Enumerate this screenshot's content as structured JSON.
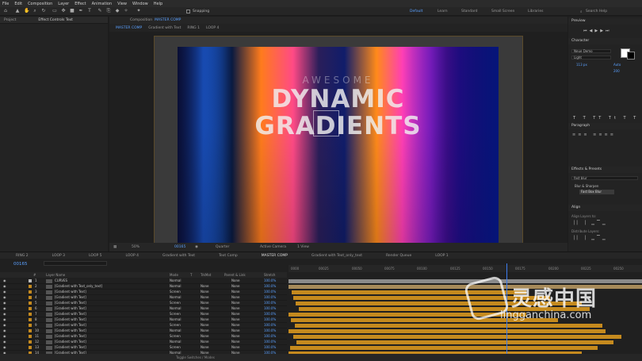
{
  "menu": [
    "File",
    "Edit",
    "Composition",
    "Layer",
    "Effect",
    "Animation",
    "View",
    "Window",
    "Help"
  ],
  "toolbar": {
    "snapping": "Snapping",
    "workspaces": [
      "Default",
      "Learn",
      "Standard",
      "Small Screen",
      "Libraries"
    ],
    "search": "Search Help"
  },
  "left_panel": {
    "tabs": [
      "Project",
      "Effect Controls Text"
    ]
  },
  "comp": {
    "tab_prefix": "Composition",
    "tab_name": "MASTER COMP",
    "crumbs": [
      "MASTER COMP",
      "Gradient with Text",
      "RING 1",
      "LOOP 4"
    ],
    "art": {
      "line1": "AWESOME",
      "line2": "DYNAMIC",
      "line3": "GRADIENTS"
    },
    "footer": {
      "zoom": "50%",
      "timecode": "00165",
      "resolution": "Quarter",
      "camera": "Active Camera",
      "view": "1 View"
    }
  },
  "right_panel": {
    "preview": "Preview",
    "character": "Character",
    "font": "Neue Demo",
    "style": "Light",
    "size": "113 px",
    "leading": "Auto",
    "tracking": "200",
    "paragraph": "Paragraph",
    "effects": "Effects & Presets",
    "effects_search": "fast blur",
    "effects_group": "Blur & Sharpen",
    "effects_item": "Fast Box Blur",
    "align": "Align",
    "align_to": "Align Layers to:",
    "distribute": "Distribute Layers:"
  },
  "bottom_tabs": [
    "RING 2",
    "LOOP 3",
    "LOOP 5",
    "LOOP 4",
    "Gradient with Text",
    "Text Comp",
    "MASTER COMP",
    "Gradient with Text_only_text",
    "Render Queue",
    "LOOP 1"
  ],
  "timeline": {
    "timecode": "00165",
    "headers": [
      "#",
      "Layer Name",
      "Mode",
      "T",
      "TrkMat",
      "Parent & Link",
      "Stretch"
    ],
    "ruler": [
      "0000",
      "00025",
      "00050",
      "00075",
      "00100",
      "00125",
      "00150",
      "00175",
      "00200",
      "00225",
      "00250"
    ],
    "layers": [
      {
        "num": "1",
        "name": "CURVES",
        "mode": "Normal",
        "trkmat": "",
        "parent": "None",
        "stretch": "100.0%"
      },
      {
        "num": "2",
        "name": "[Gradient with Text_only_text]",
        "mode": "Normal",
        "trkmat": "None",
        "parent": "None",
        "stretch": "100.0%"
      },
      {
        "num": "3",
        "name": "[Gradient with Text]",
        "mode": "Screen",
        "trkmat": "None",
        "parent": "None",
        "stretch": "100.0%"
      },
      {
        "num": "4",
        "name": "[Gradient with Text]",
        "mode": "Normal",
        "trkmat": "None",
        "parent": "None",
        "stretch": "100.0%"
      },
      {
        "num": "5",
        "name": "[Gradient with Text]",
        "mode": "Screen",
        "trkmat": "None",
        "parent": "None",
        "stretch": "100.0%"
      },
      {
        "num": "6",
        "name": "[Gradient with Text]",
        "mode": "Normal",
        "trkmat": "None",
        "parent": "None",
        "stretch": "100.0%"
      },
      {
        "num": "7",
        "name": "[Gradient with Text]",
        "mode": "Screen",
        "trkmat": "None",
        "parent": "None",
        "stretch": "100.0%"
      },
      {
        "num": "8",
        "name": "[Gradient with Text]",
        "mode": "Normal",
        "trkmat": "None",
        "parent": "None",
        "stretch": "100.0%"
      },
      {
        "num": "9",
        "name": "[Gradient with Text]",
        "mode": "Screen",
        "trkmat": "None",
        "parent": "None",
        "stretch": "100.0%"
      },
      {
        "num": "10",
        "name": "[Gradient with Text]",
        "mode": "Normal",
        "trkmat": "None",
        "parent": "None",
        "stretch": "100.0%"
      },
      {
        "num": "11",
        "name": "[Gradient with Text]",
        "mode": "Screen",
        "trkmat": "None",
        "parent": "None",
        "stretch": "100.0%"
      },
      {
        "num": "12",
        "name": "[Gradient with Text]",
        "mode": "Normal",
        "trkmat": "None",
        "parent": "None",
        "stretch": "100.0%"
      },
      {
        "num": "13",
        "name": "[Gradient with Text]",
        "mode": "Screen",
        "trkmat": "None",
        "parent": "None",
        "stretch": "100.0%"
      },
      {
        "num": "14",
        "name": "[Gradient with Text]",
        "mode": "Normal",
        "trkmat": "None",
        "parent": "None",
        "stretch": "100.0%"
      }
    ],
    "toggle": "Toggle Switches / Modes"
  },
  "watermark": {
    "cn": "灵感中国",
    "en": "lingganchina.com"
  }
}
